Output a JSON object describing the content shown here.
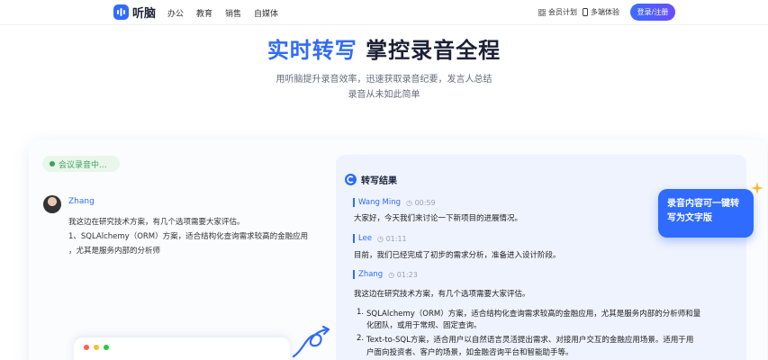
{
  "header": {
    "logo_text": "听脑",
    "nav": [
      "办公",
      "教育",
      "销售",
      "自媒体"
    ],
    "util_links": [
      {
        "icon": "grid-icon",
        "label": "会员计划"
      },
      {
        "icon": "phone-icon",
        "label": "多端体验"
      }
    ],
    "login_label": "登录/注册"
  },
  "hero": {
    "title_accent": "实时转写",
    "title_rest": "掌控录音全程",
    "subtitle_line1": "用听脑提升录音效率，迅速获取录音纪要，发言人总结",
    "subtitle_line2": "录音从未如此简单"
  },
  "recording": {
    "chip_label": "会议录音中...",
    "speaker_name": "Zhang",
    "lines": [
      "我这边在研究技术方案，有几个选项需要大家评估。",
      "1、SQLAlchemy（ORM）方案，适合结构化查询需求较高的金融应用",
      "，尤其是服务内部的分析师"
    ]
  },
  "transcript": {
    "title": "转写结果",
    "entries": [
      {
        "speaker": "Wang Ming",
        "time": "00:59",
        "text": "大家好，今天我们来讨论一下新项目的进展情况。"
      },
      {
        "speaker": "Lee",
        "time": "01:11",
        "text": "目前，我们已经完成了初步的需求分析，准备进入设计阶段。"
      },
      {
        "speaker": "Zhang",
        "time": "01:23",
        "text": "我这边在研究技术方案，有几个选项需要大家评估。"
      }
    ],
    "list_items": [
      {
        "num": "1.",
        "line1": "SQLAlchemy（ORM）方案，适合结构化查询需求较高的金融应用，尤其是服务内部的分析师和量",
        "line2": "化团队，或用于常规、固定查询。"
      },
      {
        "num": "2.",
        "line1": "Text-to-SQL方案，适合用户以自然语言灵活提出需求、对接用户交互的金融应用场景。适用于用",
        "line2": "户面向投资者、客户的场景，如金融咨询平台和智能助手等。"
      }
    ]
  },
  "tooltip": {
    "line1": "录音内容可一键转",
    "line2": "写为文字版"
  },
  "colors": {
    "brand": "#2f6bff",
    "recording_green": "#3aa35a",
    "panel_bg": "#eef3fd"
  }
}
